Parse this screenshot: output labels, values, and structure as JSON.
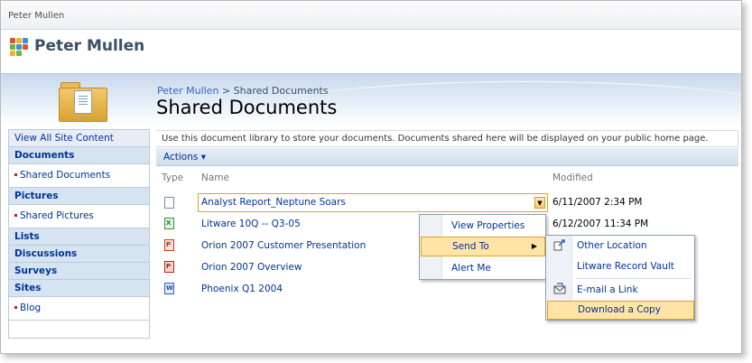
{
  "topbar": {
    "user_name": "Peter Mullen"
  },
  "site": {
    "title": "Peter Mullen"
  },
  "breadcrumb": {
    "site": "Peter Mullen",
    "separator": ">",
    "current": "Shared Documents"
  },
  "page": {
    "title": "Shared Documents",
    "description": "Use this document library to store your documents. Documents shared here will be displayed on your public home page."
  },
  "toolbar": {
    "actions_label": "Actions",
    "actions_caret": "▾"
  },
  "columns": {
    "type": "Type",
    "name": "Name",
    "modified": "Modified"
  },
  "leftnav": {
    "view_all": "View All Site Content",
    "documents_heading": "Documents",
    "shared_documents": "Shared Documents",
    "pictures_heading": "Pictures",
    "shared_pictures": "Shared Pictures",
    "lists_heading": "Lists",
    "discussions_heading": "Discussions",
    "surveys_heading": "Surveys",
    "sites_heading": "Sites",
    "blog": "Blog"
  },
  "rows": [
    {
      "name": "Analyst Report_Neptune Soars",
      "modified": "6/11/2007 2:34 PM",
      "icon": "generic-doc-icon"
    },
    {
      "name": "Litware 10Q -- Q3-05",
      "modified": "6/12/2007 11:34 PM",
      "icon": "excel-icon"
    },
    {
      "name": "Orion 2007 Customer Presentation",
      "modified": "",
      "icon": "powerpoint-icon"
    },
    {
      "name": "Orion 2007 Overview",
      "modified": "",
      "icon": "powerpoint-icon"
    },
    {
      "name": "Phoenix Q1 2004",
      "modified": "",
      "icon": "word-icon"
    }
  ],
  "context_menu": {
    "view_properties": "View Properties",
    "send_to": "Send To",
    "send_to_arrow": "▶",
    "alert_me": "Alert Me"
  },
  "send_to_menu": {
    "other_location": "Other Location",
    "record_vault": "Litware Record Vault",
    "email_link": "E-mail a Link",
    "download_copy": "Download a Copy"
  },
  "icons": {
    "excel_glyph": "X",
    "powerpoint_glyph": "P",
    "word_glyph": "W"
  }
}
